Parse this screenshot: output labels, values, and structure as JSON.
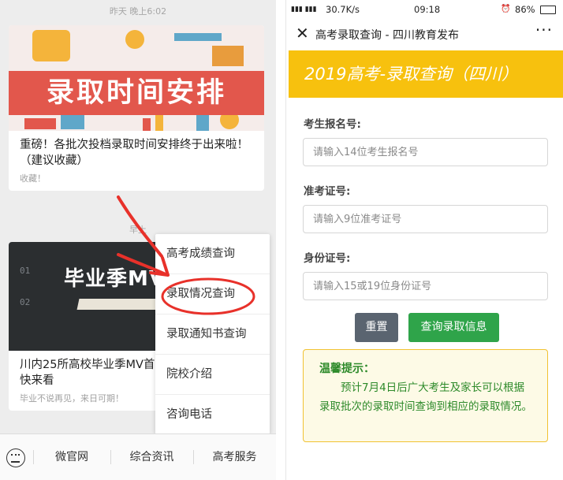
{
  "left": {
    "timestamp_1": "昨天 晚上6:02",
    "article_1": {
      "cover_text": "录取时间安排",
      "title": "重磅！各批次投档录取时间安排终于出来啦！（建议收藏）",
      "subtitle": "收藏！"
    },
    "timestamp_2": "早上",
    "article_2": {
      "cover_text": "毕业季MV",
      "title": "川内25所高校毕业季MV首MV最能打动你心？快来看",
      "subtitle": "毕业不说再见，来日可期！"
    },
    "menu": {
      "items": [
        {
          "label": "高考成绩查询"
        },
        {
          "label": "录取情况查询"
        },
        {
          "label": "录取通知书查询"
        },
        {
          "label": "院校介绍"
        },
        {
          "label": "咨询电话"
        }
      ]
    },
    "bottom_bar": {
      "keyboard_icon": "keyboard-icon",
      "items": [
        {
          "label": "微官网"
        },
        {
          "label": "综合资讯"
        },
        {
          "label": "高考服务"
        }
      ]
    },
    "annotation_color": "#e8312a"
  },
  "right": {
    "status_bar": {
      "network": "30.7K/s",
      "time": "09:18",
      "battery": "86%"
    },
    "nav": {
      "title": "高考录取查询 - 四川教育发布"
    },
    "banner": {
      "title": "2019高考-录取查询（四川）",
      "color": "#f7c10e"
    },
    "form": {
      "exam_no_label": "考生报名号:",
      "exam_no_placeholder": "请输入14位考生报名号",
      "ticket_no_label": "准考证号:",
      "ticket_no_placeholder": "请输入9位准考证号",
      "id_no_label": "身份证号:",
      "id_no_placeholder": "请输入15或19位身份证号",
      "reset_label": "重置",
      "submit_label": "查询录取信息"
    },
    "tip": {
      "title": "温馨提示：",
      "body": "预计7月4日后广大考生及家长可以根据录取批次的录取时间查询到相应的录取情况。"
    }
  }
}
